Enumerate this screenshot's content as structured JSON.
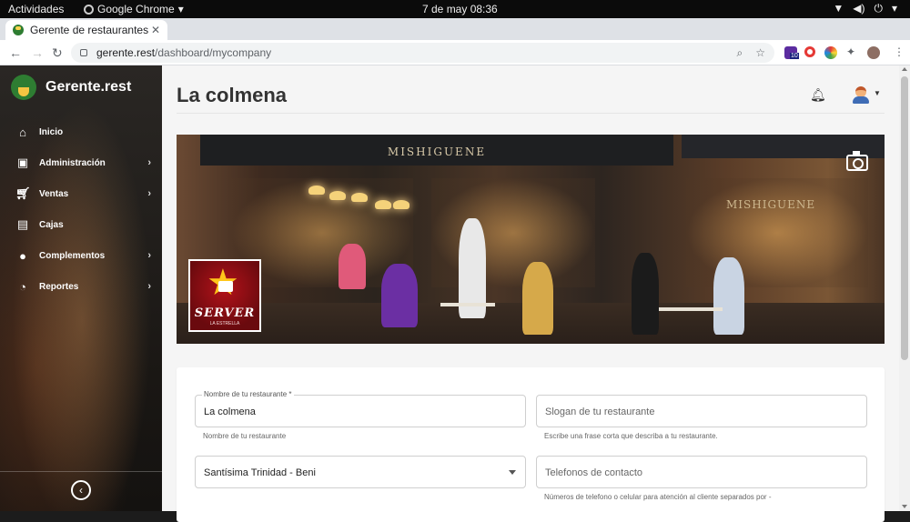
{
  "gnome": {
    "activities": "Actividades",
    "app_name": "Google Chrome",
    "clock": "7 de may  08:36"
  },
  "browser": {
    "tab_title": "Gerente de restaurantes",
    "url_host": "gerente.rest",
    "url_path": "/dashboard/mycompany",
    "extension_badge": "10"
  },
  "sidebar": {
    "brand": "Gerente.rest",
    "items": [
      {
        "label": "Inicio",
        "icon": "home-icon",
        "has_submenu": false
      },
      {
        "label": "Administración",
        "icon": "briefcase-icon",
        "has_submenu": true
      },
      {
        "label": "Ventas",
        "icon": "cart-icon",
        "has_submenu": true
      },
      {
        "label": "Cajas",
        "icon": "cash-icon",
        "has_submenu": false
      },
      {
        "label": "Complementos",
        "icon": "lightbulb-icon",
        "has_submenu": true
      },
      {
        "label": "Reportes",
        "icon": "pie-chart-icon",
        "has_submenu": true
      }
    ]
  },
  "header": {
    "title": "La colmena"
  },
  "cover": {
    "sign_text": "MISHIGUENE",
    "sign_text_2": "MISHIGUENE",
    "logo_text": "SERVER",
    "logo_subtext": "LA ESTRELLA"
  },
  "form": {
    "name_label": "Nombre de tu restaurante *",
    "name_value": "La colmena",
    "name_hint": "Nombre de tu restaurante",
    "slogan_placeholder": "Slogan de tu restaurante",
    "slogan_hint": "Escribe una frase corta que describa a tu restaurante.",
    "location_value": "Santísima Trinidad - Beni",
    "phone_placeholder": "Telefonos de contacto",
    "phone_hint": "Números de telefono o celular para atención al cliente separados por -"
  },
  "colors": {
    "sidebar_bg": "#211e1b",
    "main_bg": "#f5f5f5",
    "brand_green": "#2e7d32"
  }
}
